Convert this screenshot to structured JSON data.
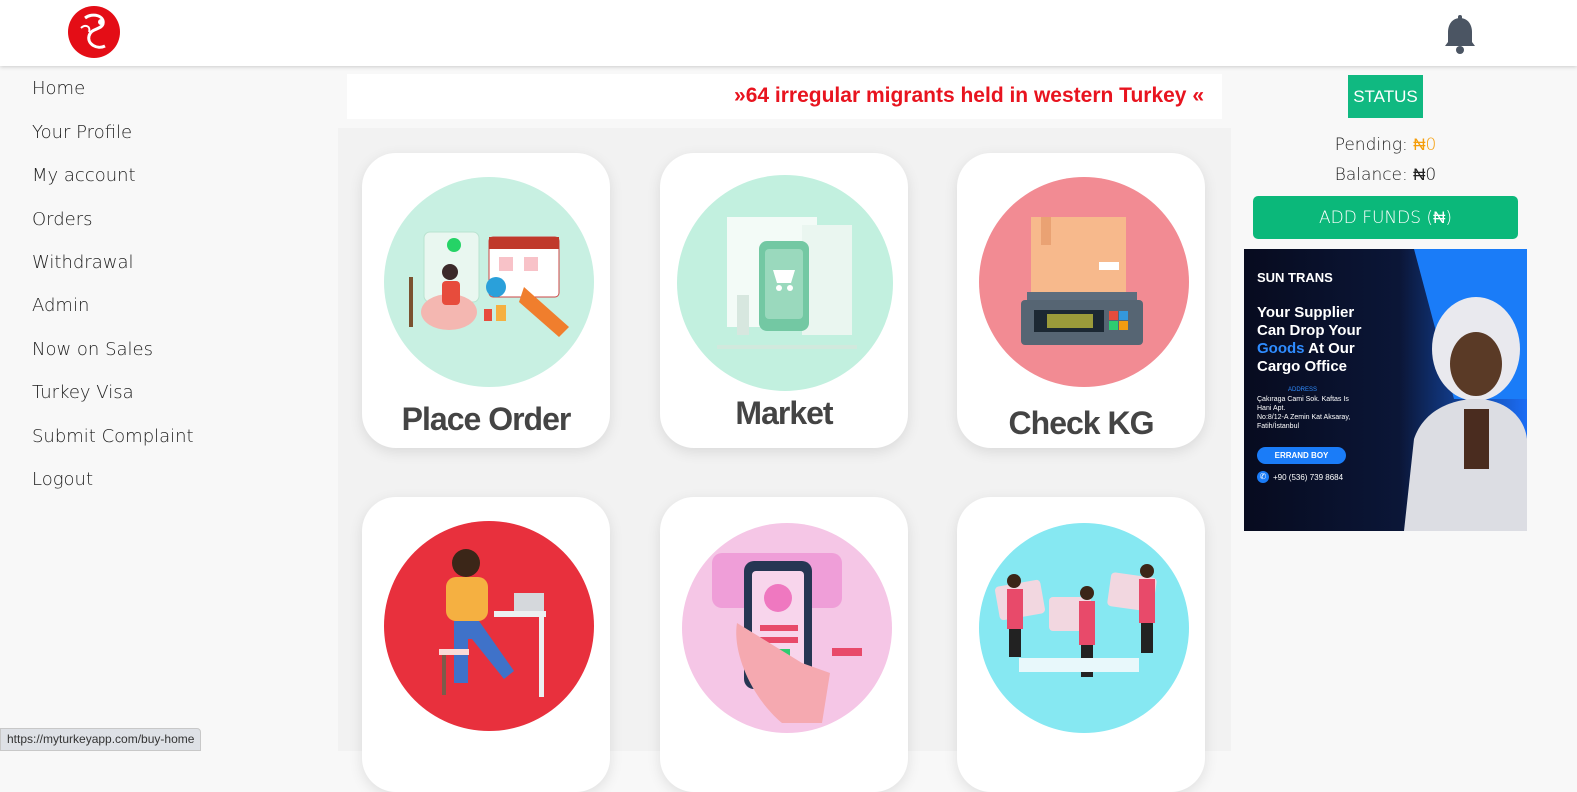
{
  "brand": {
    "logo_icon": "brand-logo-icon"
  },
  "header": {
    "notification_icon": "bell-icon"
  },
  "sidebar": {
    "items": [
      {
        "label": "Home"
      },
      {
        "label": "Your Profile"
      },
      {
        "label": "My account"
      },
      {
        "label": "Orders"
      },
      {
        "label": "Withdrawal"
      },
      {
        "label": "Admin"
      },
      {
        "label": "Now on Sales"
      },
      {
        "label": "Turkey Visa"
      },
      {
        "label": "Submit Complaint"
      },
      {
        "label": "Logout"
      }
    ]
  },
  "ticker": {
    "text": "»64 irregular migrants held in western Turkey «"
  },
  "cards": [
    {
      "label": "Place Order",
      "bg": "#c8f0e2"
    },
    {
      "label": "Market",
      "bg": "#c2f0df"
    },
    {
      "label": "Check KG",
      "bg": "#f28b93"
    },
    {
      "label": "",
      "bg": "#e8303d"
    },
    {
      "label": "",
      "bg": "#f5c6e6"
    },
    {
      "label": "",
      "bg": "#86e8f2"
    }
  ],
  "status_panel": {
    "status_label": "STATUS",
    "pending_label": "Pending:",
    "pending_value": "₦0",
    "balance_label": "Balance:",
    "balance_value": "₦0",
    "add_funds_label": "ADD FUNDS (₦)"
  },
  "ad": {
    "brand": "SUN TRANS",
    "headline_1": "Your Supplier",
    "headline_2": "Can Drop Your",
    "headline_3a": "Goods",
    "headline_3b": " At Our",
    "headline_4": "Cargo Office",
    "address_label": "ADDRESS",
    "address_1": "Çakıraga Cami Sok. Kaftas Is",
    "address_2": "Hani Apt.",
    "address_3": "No:8/12-A Zemin Kat Aksaray,",
    "address_4": "Fatih/İstanbul",
    "cta": "ERRAND BOY",
    "phone": "+90 (536) 739 8684"
  },
  "status_bar": {
    "url": "https://myturkeyapp.com/buy-home"
  },
  "colors": {
    "accent": "#10b981",
    "ticker": "#e8141f",
    "pending": "#f59e0b"
  }
}
